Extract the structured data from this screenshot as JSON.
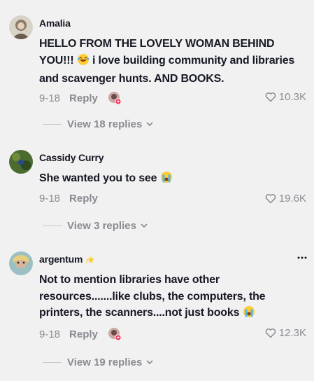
{
  "comments": [
    {
      "username": "Amalia",
      "text": "HELLO FROM THE LOVELY WOMAN BEHIND YOU!!!",
      "text2": " i love building community and libraries and scavenger hunts. AND BOOKS.",
      "date": "9-18",
      "reply_label": "Reply",
      "likes": "10.3K",
      "view_replies": "View 18 replies",
      "emoji": "laughing-face",
      "avatar_color": "#6b5a4e"
    },
    {
      "username": "Cassidy Curry",
      "text": "She wanted you to see",
      "date": "9-18",
      "reply_label": "Reply",
      "likes": "19.6K",
      "view_replies": "View 3 replies",
      "emoji": "crying-face",
      "avatar_color": "#3f5a2a"
    },
    {
      "username": "argentum",
      "username_emoji": "dizzy-star",
      "text": "Not to mention libraries have other resources.......like clubs, the computers, the printers, the scanners....not just books",
      "date": "9-18",
      "reply_label": "Reply",
      "likes": "12.3K",
      "view_replies": "View 19 replies",
      "emoji": "crying-face",
      "avatar_color": "#7fa3a8"
    }
  ],
  "colors": {
    "background": "#f1f1f2",
    "text": "#161823",
    "muted": "#8a8b91",
    "heart_badge": "#fe2c55"
  }
}
